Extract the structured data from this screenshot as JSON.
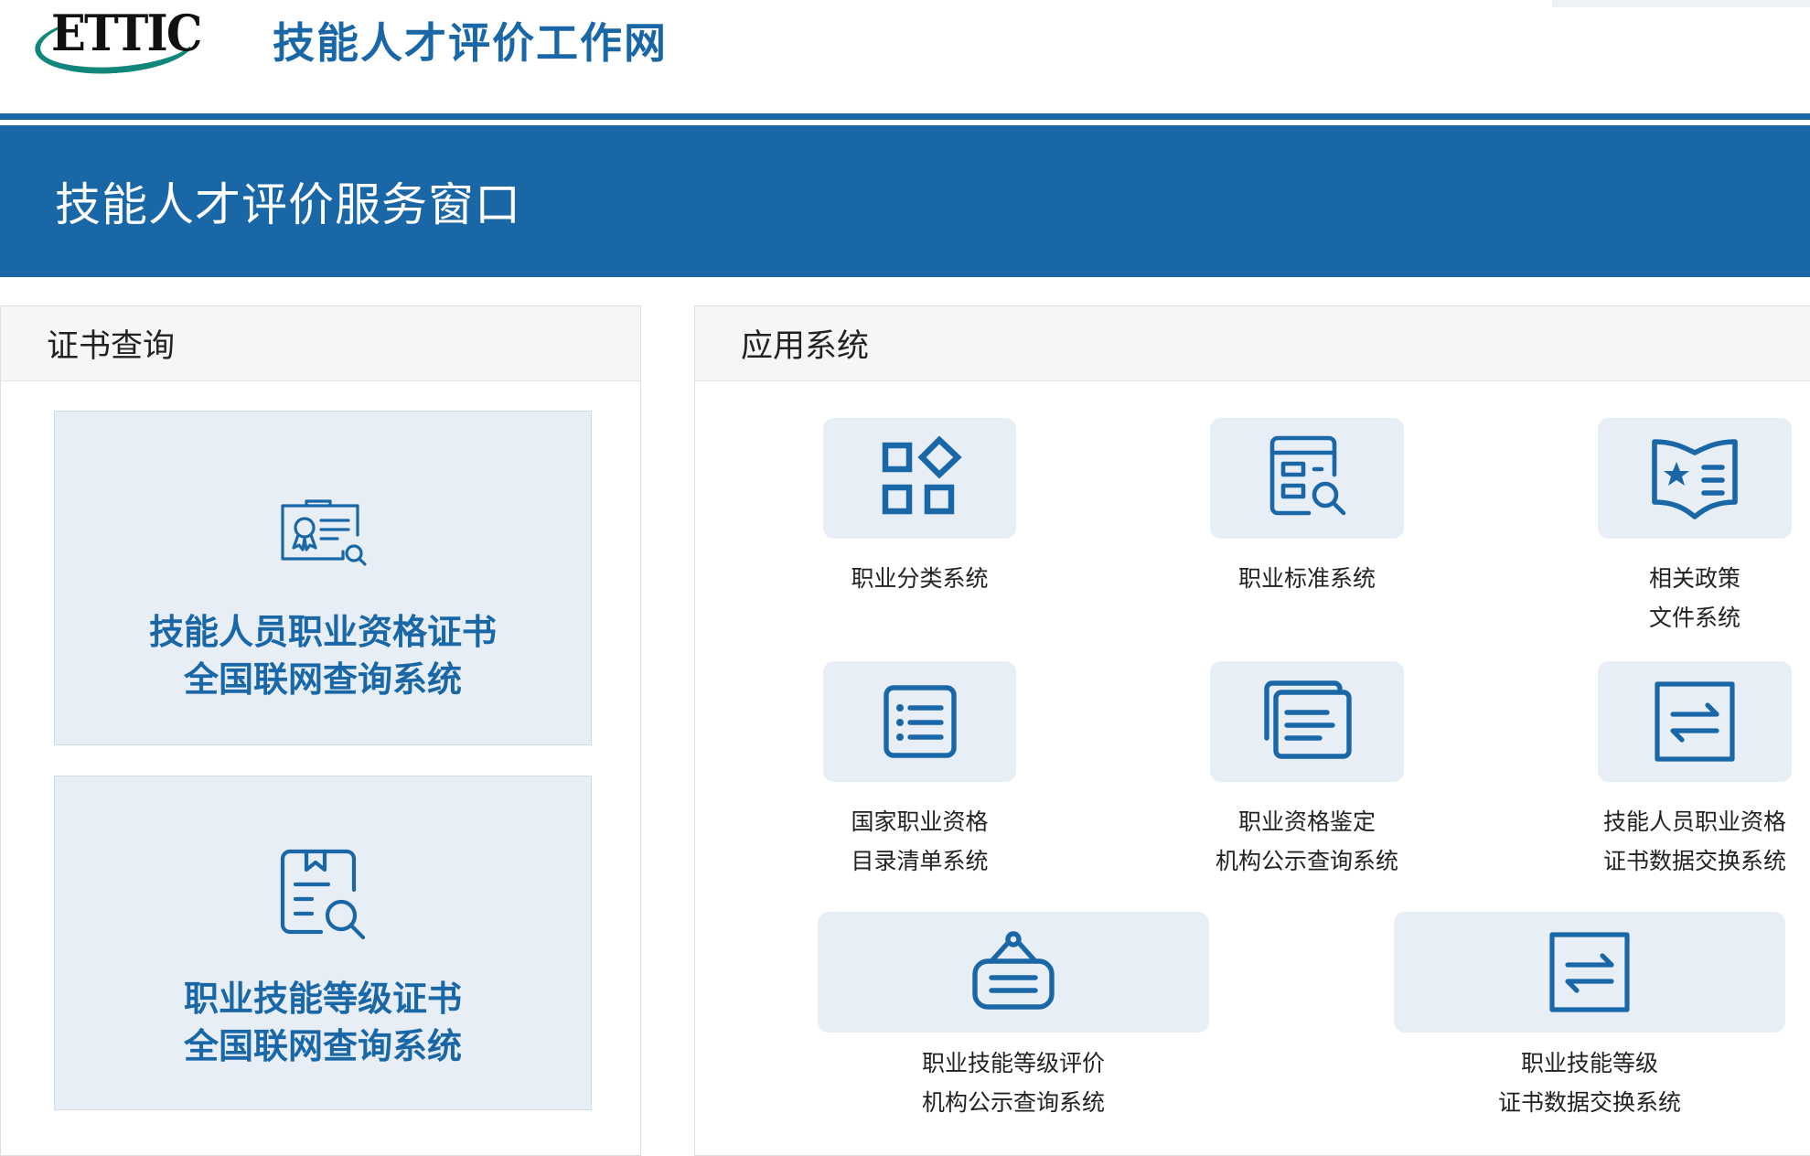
{
  "header": {
    "logo_text": "ETTIC",
    "site_title": "技能人才评价工作网"
  },
  "banner": {
    "title": "技能人才评价服务窗口"
  },
  "certificate_panel": {
    "title": "证书查询",
    "cards": [
      {
        "line1": "技能人员职业资格证书",
        "line2": "全国联网查询系统",
        "icon": "certificate-search-icon"
      },
      {
        "line1": "职业技能等级证书",
        "line2": "全国联网查询系统",
        "icon": "document-search-icon"
      }
    ]
  },
  "apps_panel": {
    "title": "应用系统",
    "tiles": [
      {
        "line1": "职业分类系统",
        "line2": "",
        "icon": "grid-diamond-icon"
      },
      {
        "line1": "职业标准系统",
        "line2": "",
        "icon": "form-search-icon"
      },
      {
        "line1": "相关政策",
        "line2": "文件系统",
        "icon": "policy-book-icon"
      },
      {
        "line1": "国家职业资格",
        "line2": "目录清单系统",
        "icon": "list-icon"
      },
      {
        "line1": "职业资格鉴定",
        "line2": "机构公示查询系统",
        "icon": "stacked-documents-icon"
      },
      {
        "line1": "技能人员职业资格",
        "line2": "证书数据交换系统",
        "icon": "exchange-icon"
      },
      {
        "line1": "职业技能等级评价",
        "line2": "机构公示查询系统",
        "icon": "hanging-sign-icon"
      },
      {
        "line1": "职业技能等级",
        "line2": "证书数据交换系统",
        "icon": "exchange-icon"
      }
    ]
  },
  "colors": {
    "brand_blue": "#1a67a8",
    "logo_green": "#11867a",
    "tile_background": "#e8eef6",
    "panel_header": "#f6f6f5"
  }
}
